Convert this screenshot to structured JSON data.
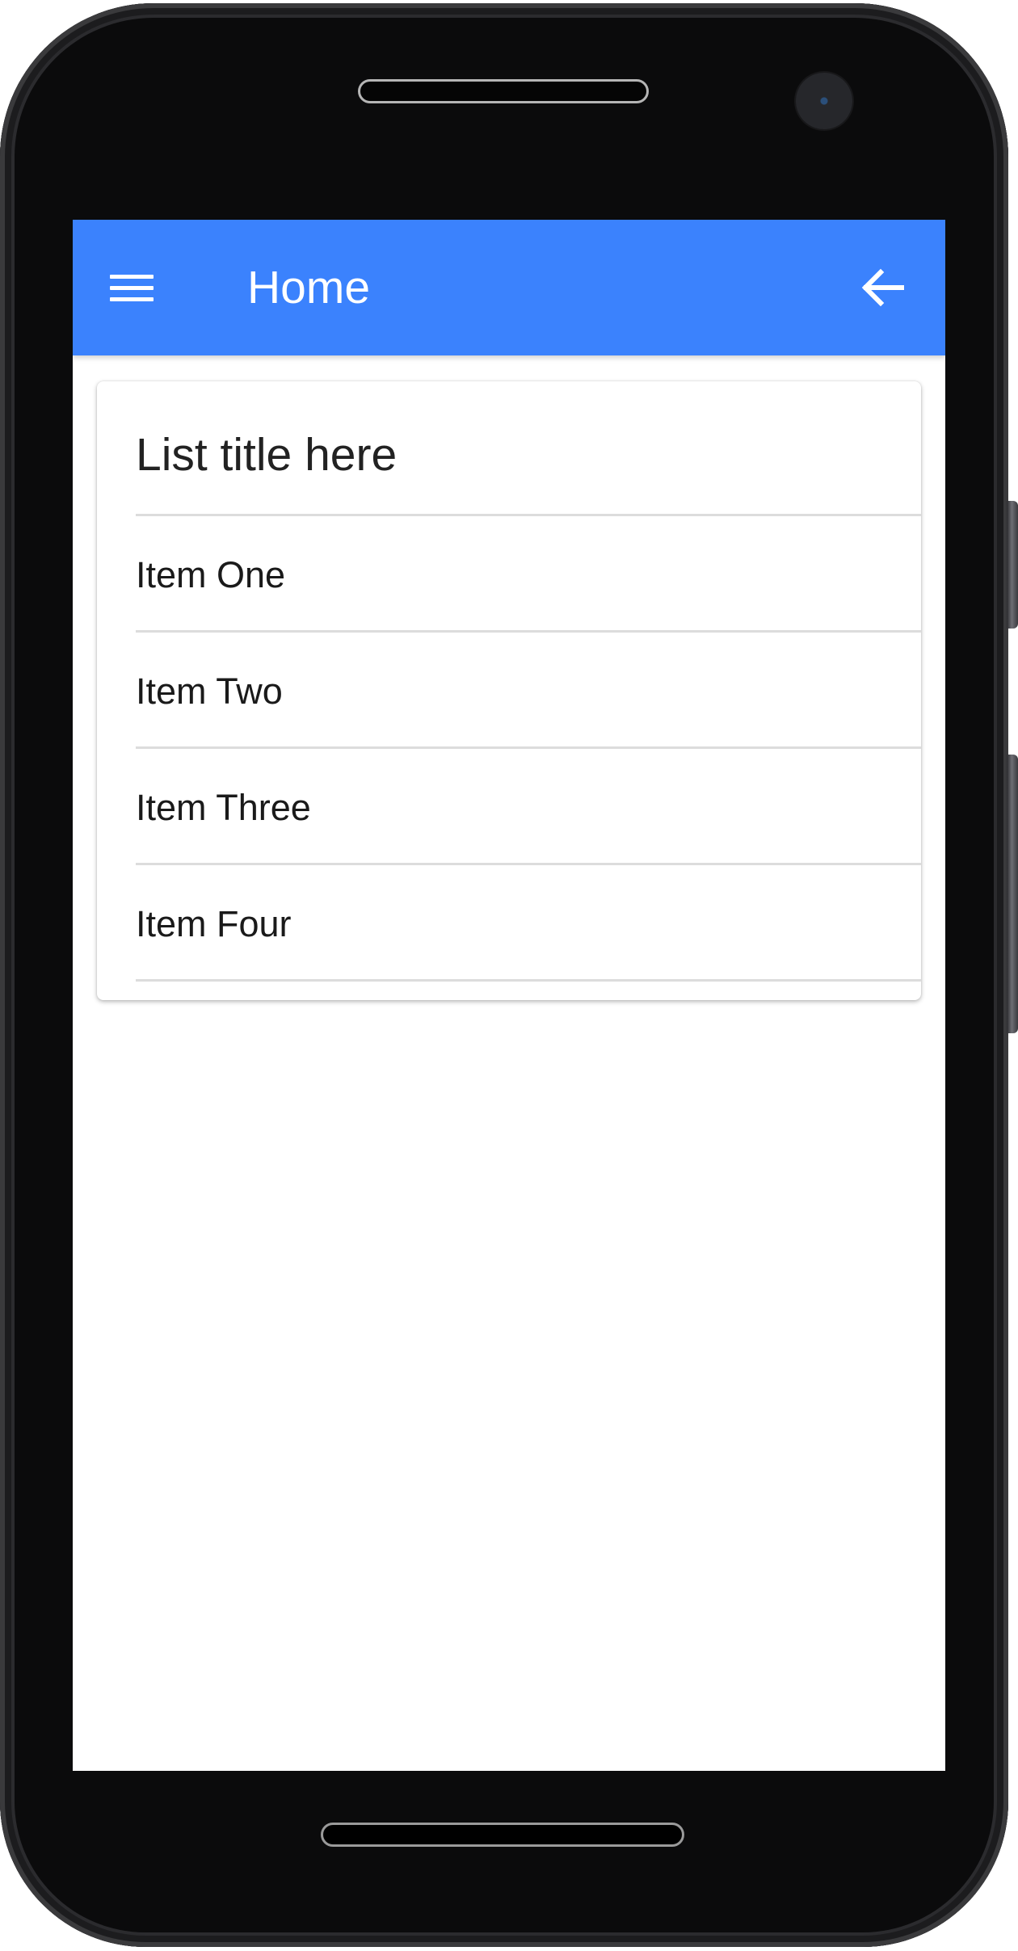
{
  "app_bar": {
    "title": "Home",
    "menu_icon": "hamburger-menu-icon",
    "back_icon": "arrow-back-icon",
    "color": "#3b82fd"
  },
  "list": {
    "title": "List title here",
    "items": [
      {
        "label": "Item One"
      },
      {
        "label": "Item Two"
      },
      {
        "label": "Item Three"
      },
      {
        "label": "Item Four"
      }
    ]
  }
}
